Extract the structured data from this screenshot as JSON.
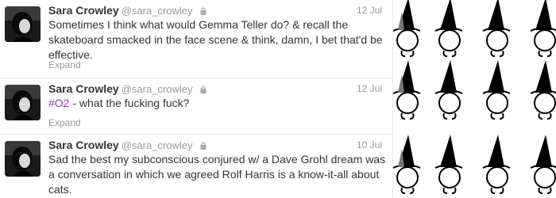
{
  "tweets": [
    {
      "name": "Sara Crowley",
      "screen_name": "@sara_crowley",
      "time": "12 Jul",
      "text": "Sometimes I think what would Gemma Teller do? & recall the skateboard smacked in the face scene & think, damn, I bet that'd be effective.",
      "expand": "Expand"
    },
    {
      "name": "Sara Crowley",
      "screen_name": "@sara_crowley",
      "time": "12 Jul",
      "hashtag": "#O2",
      "text": " - what the fucking fuck?",
      "expand": "Expand"
    },
    {
      "name": "Sara Crowley",
      "screen_name": "@sara_crowley",
      "time": "10 Jul",
      "text": "Sad the best my subconscious conjured w/ a Dave Grohl dream was a conversation in which we agreed Rolf Harris is a know-it-all about cats."
    }
  ],
  "colors": {
    "hashtag": "#8a3fc2",
    "name": "#333333",
    "meta": "#999999"
  },
  "icons": {
    "protected": "lock-icon",
    "background": "witch-hat-pattern"
  }
}
